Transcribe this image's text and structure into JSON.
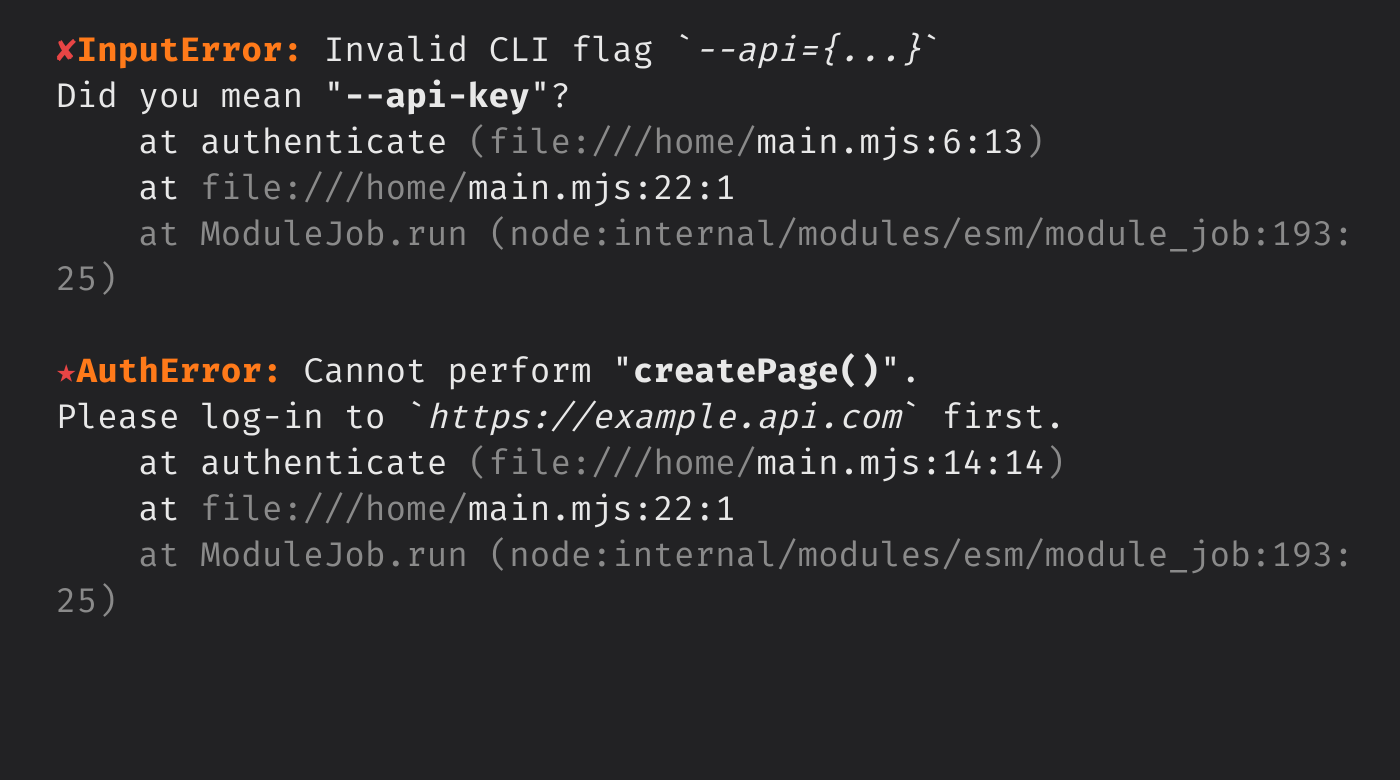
{
  "errors": [
    {
      "icon": "✘",
      "type": "InputError:",
      "msg_pre": " Invalid CLI flag `",
      "msg_code": "--api={...}",
      "msg_post": "`",
      "hint_pre": "Did you mean \"",
      "hint_bold": "--api-key",
      "hint_post": "\"?",
      "frames": [
        {
          "at": "    at ",
          "fn": "authenticate ",
          "lp": "(",
          "dim1": "file:///home/",
          "file": "main.mjs:6:13",
          "rp": ")"
        },
        {
          "at": "    at ",
          "fn": "",
          "lp": "",
          "dim1": "file:///home/",
          "file": "main.mjs:22:1",
          "rp": ""
        },
        {
          "full_dim": "    at ModuleJob.run (node:internal/modules/esm/module_job:193:25)"
        }
      ]
    },
    {
      "icon": "★",
      "type": "AuthError:",
      "msg_pre": " Cannot perform \"",
      "msg_bold": "createPage()",
      "msg_post": "\".",
      "hint_pre": "Please log-in to `",
      "hint_code": "https://example.api.com",
      "hint_post": "` first.",
      "frames": [
        {
          "at": "    at ",
          "fn": "authenticate ",
          "lp": "(",
          "dim1": "file:///home/",
          "file": "main.mjs:14:14",
          "rp": ")"
        },
        {
          "at": "    at ",
          "fn": "",
          "lp": "",
          "dim1": "file:///home/",
          "file": "main.mjs:22:1",
          "rp": ""
        },
        {
          "full_dim": "    at ModuleJob.run (node:internal/modules/esm/module_job:193:25)"
        }
      ]
    }
  ]
}
